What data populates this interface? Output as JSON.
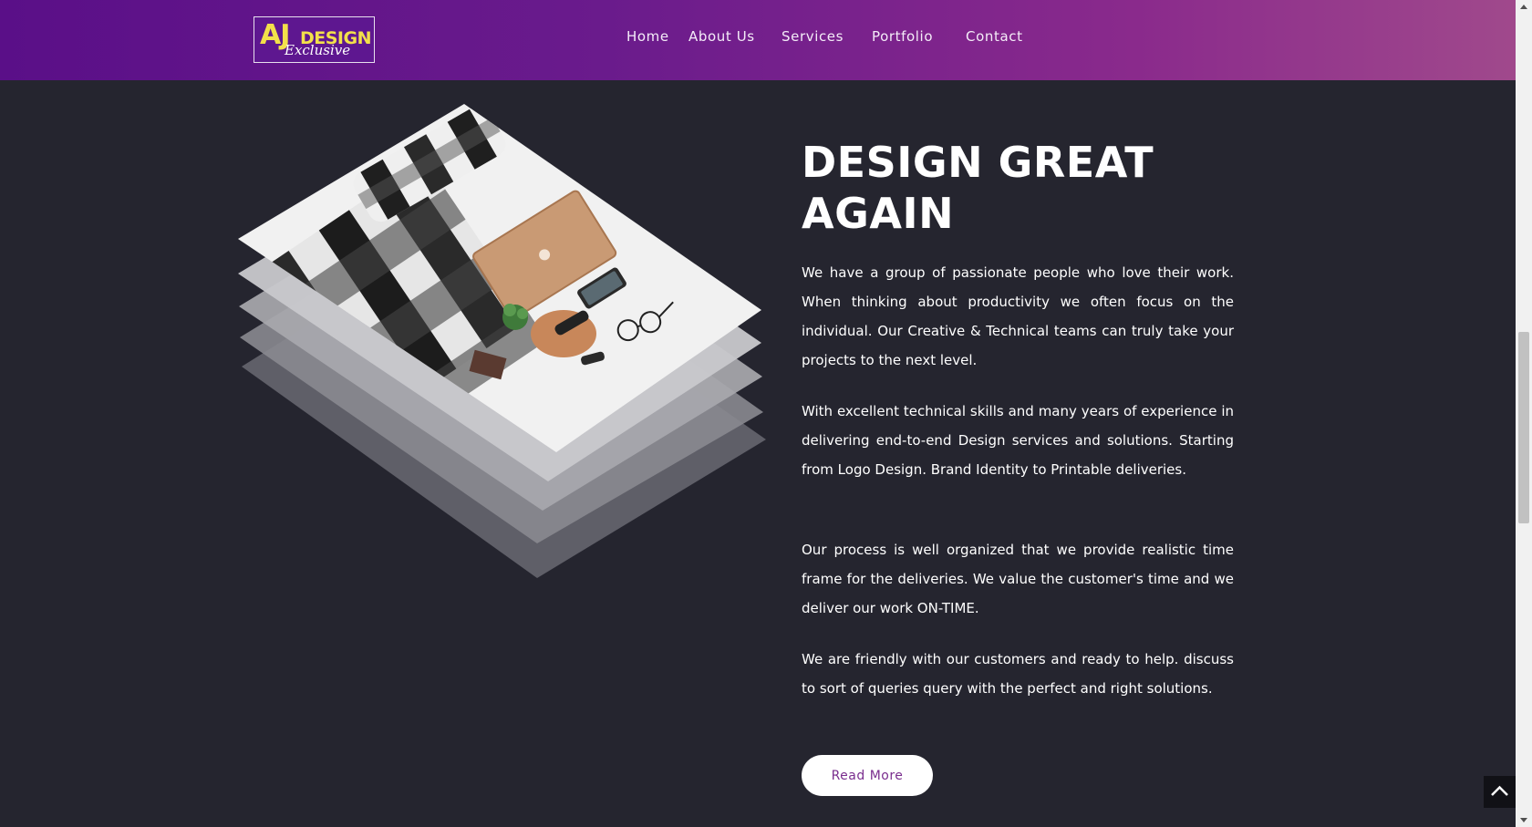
{
  "brand": {
    "logo_aj": "AJ",
    "logo_design": "DESIGN",
    "logo_exclusive": "Exclusive"
  },
  "nav": {
    "items": [
      {
        "label": "Home"
      },
      {
        "label": "About Us"
      },
      {
        "label": "Services"
      },
      {
        "label": "Portfolio"
      },
      {
        "label": "Contact"
      }
    ]
  },
  "hero": {
    "heading_line1": "DESIGN GREAT",
    "heading_line2": "AGAIN",
    "paragraphs": [
      "We have a group of passionate people who love their work. When thinking about productivity we often focus on the individual. Our Creative & Technical teams can truly take your projects to the next level.",
      "With excellent technical skills and many years of experience in delivering end-to-end Design services and solutions. Starting from Logo Design. Brand Identity to Printable deliveries.",
      "Our process is well organized that we provide realistic time frame for the deliveries. We value the customer's time and we deliver our work ON-TIME.",
      "We are friendly with our customers and ready to help. discuss to sort of queries query with the perfect and right solutions."
    ],
    "read_more_label": "Read More"
  },
  "colors": {
    "header_gradient_start": "#5a0f88",
    "header_gradient_end": "#a0498c",
    "page_background": "#25252f",
    "logo_yellow": "#f2e04a",
    "button_text": "#7a2e8e"
  },
  "icons": {
    "scroll_to_top": "chevron-up-icon"
  },
  "scrollbar": {
    "position_fraction": 0.39
  }
}
